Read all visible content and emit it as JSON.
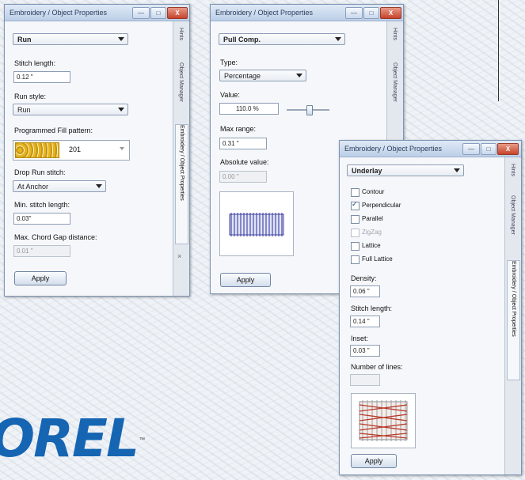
{
  "brand": {
    "logo_text": "OREL",
    "trademark": "™",
    "color": "#1565b3"
  },
  "window_controls": {
    "minimize": "—",
    "maximize": "□",
    "close": "X"
  },
  "win1": {
    "title": "Embroidery / Object Properties",
    "type_select": "Run",
    "stitch_length_label": "Stitch length:",
    "stitch_length_value": "0.12 \"",
    "run_style_label": "Run style:",
    "run_style_value": "Run",
    "fill_pattern_label": "Programmed Fill pattern:",
    "fill_pattern_number": "201",
    "drop_run_label": "Drop Run stitch:",
    "drop_run_value": "At Anchor",
    "min_stitch_label": "Min. stitch length:",
    "min_stitch_value": "0.03\"",
    "max_chord_label": "Max. Chord Gap distance:",
    "max_chord_value": "0.01 \"",
    "apply_label": "Apply",
    "side_tabs": [
      "Hints",
      "Object Manager",
      "Embroidery / Object Properties"
    ],
    "side_close": "×"
  },
  "win2": {
    "title": "Embroidery / Object Properties",
    "type_select": "Pull Comp.",
    "type_label": "Type:",
    "type_value": "Percentage",
    "value_label": "Value:",
    "value_value": "110.0 %",
    "slider_level": 0.55,
    "max_range_label": "Max range:",
    "max_range_value": "0.31 \"",
    "absolute_label": "Absolute value:",
    "absolute_value": "0.00 \"",
    "apply_label": "Apply",
    "side_tabs": [
      "Hints",
      "Object Manager"
    ]
  },
  "win3": {
    "title": "Embroidery / Object Properties",
    "type_select": "Underlay",
    "options": [
      {
        "label": "Contour",
        "checked": false,
        "enabled": true
      },
      {
        "label": "Perpendicular",
        "checked": true,
        "enabled": true
      },
      {
        "label": "Parallel",
        "checked": false,
        "enabled": true
      },
      {
        "label": "ZigZag",
        "checked": false,
        "enabled": false
      },
      {
        "label": "Lattice",
        "checked": false,
        "enabled": true
      },
      {
        "label": "Full Lattice",
        "checked": false,
        "enabled": true
      }
    ],
    "density_label": "Density:",
    "density_value": "0.06 \"",
    "stitch_length_label": "Stitch length:",
    "stitch_length_value": "0.14 \"",
    "inset_label": "Inset:",
    "inset_value": "0.03 \"",
    "lines_label": "Number of lines:",
    "lines_value": "",
    "apply_label": "Apply",
    "side_tabs": [
      "Hints",
      "Object Manager",
      "Embroidery / Object Properties"
    ]
  }
}
